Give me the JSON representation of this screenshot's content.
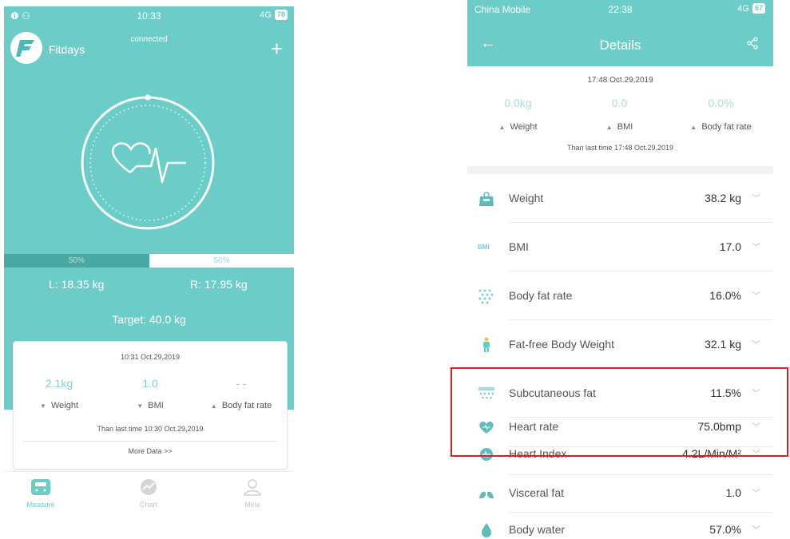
{
  "left_phone": {
    "status": {
      "carrier_icons": "❶ ⚇",
      "time": "10:33",
      "signal": "4G",
      "battery": "78"
    },
    "app_name": "Fitdays",
    "connection": "connected",
    "add_icon": "plus-icon",
    "balance": {
      "left_percent": "50%",
      "right_percent": "50%",
      "left_weight": "L: 18.35 kg",
      "right_weight": "R: 17.95 kg"
    },
    "target": "Target: 40.0 kg",
    "card": {
      "timestamp": "10:31 Oct.29,2019",
      "values": [
        "2.1kg",
        "1.0",
        "- -"
      ],
      "labels": [
        "Weight",
        "BMI",
        "Body fat rate"
      ],
      "arrows": [
        "▼",
        "▼",
        "▲"
      ],
      "than_last": "Than last time 10:30 Oct.29,2019",
      "more": "More Data >>"
    },
    "tabs": [
      {
        "label": "Measure",
        "icon": "scale-icon",
        "active": true
      },
      {
        "label": "Chart",
        "icon": "chart-icon",
        "active": false
      },
      {
        "label": "Mine",
        "icon": "person-icon",
        "active": false
      }
    ],
    "colors": {
      "accent": "#6ccdc8",
      "bar_dark": "#4aa8a3"
    }
  },
  "right_phone": {
    "status": {
      "carrier": "China Mobile",
      "time": "22:38",
      "signal": "4G",
      "battery": "67"
    },
    "title": "Details",
    "summary": {
      "timestamp": "17:48 Oct.29,2019",
      "values": [
        "0.0kg",
        "0.0",
        "0.0%"
      ],
      "labels": [
        "Weight",
        "BMI",
        "Body fat rate"
      ],
      "arrows": [
        "▲",
        "▲",
        "▲"
      ],
      "than_last": "Than last time 17:48 Oct.29,2019"
    },
    "metrics": [
      {
        "label": "Weight",
        "value": "38.2 kg",
        "icon": "scale-icon"
      },
      {
        "label": "BMI",
        "value": "17.0",
        "icon": "bmi-icon",
        "icon_text": "BMI"
      },
      {
        "label": "Body fat rate",
        "value": "16.0%",
        "icon": "body-fat-icon"
      },
      {
        "label": "Fat-free Body Weight",
        "value": "32.1 kg",
        "icon": "person-icon"
      },
      {
        "label": "Subcutaneous fat",
        "value": "11.5%",
        "icon": "subcutaneous-fat-icon"
      },
      {
        "label": "Heart rate",
        "value": "75.0bmp",
        "icon": "heart-icon"
      },
      {
        "label": "Heart Index",
        "value": "4.2L/Min/M²",
        "icon": "heart-index-icon"
      },
      {
        "label": "Visceral fat",
        "value": "1.0",
        "icon": "lungs-icon"
      },
      {
        "label": "Body water",
        "value": "57.0%",
        "icon": "water-drop-icon"
      }
    ],
    "highlight_color": "#dc1f26"
  }
}
